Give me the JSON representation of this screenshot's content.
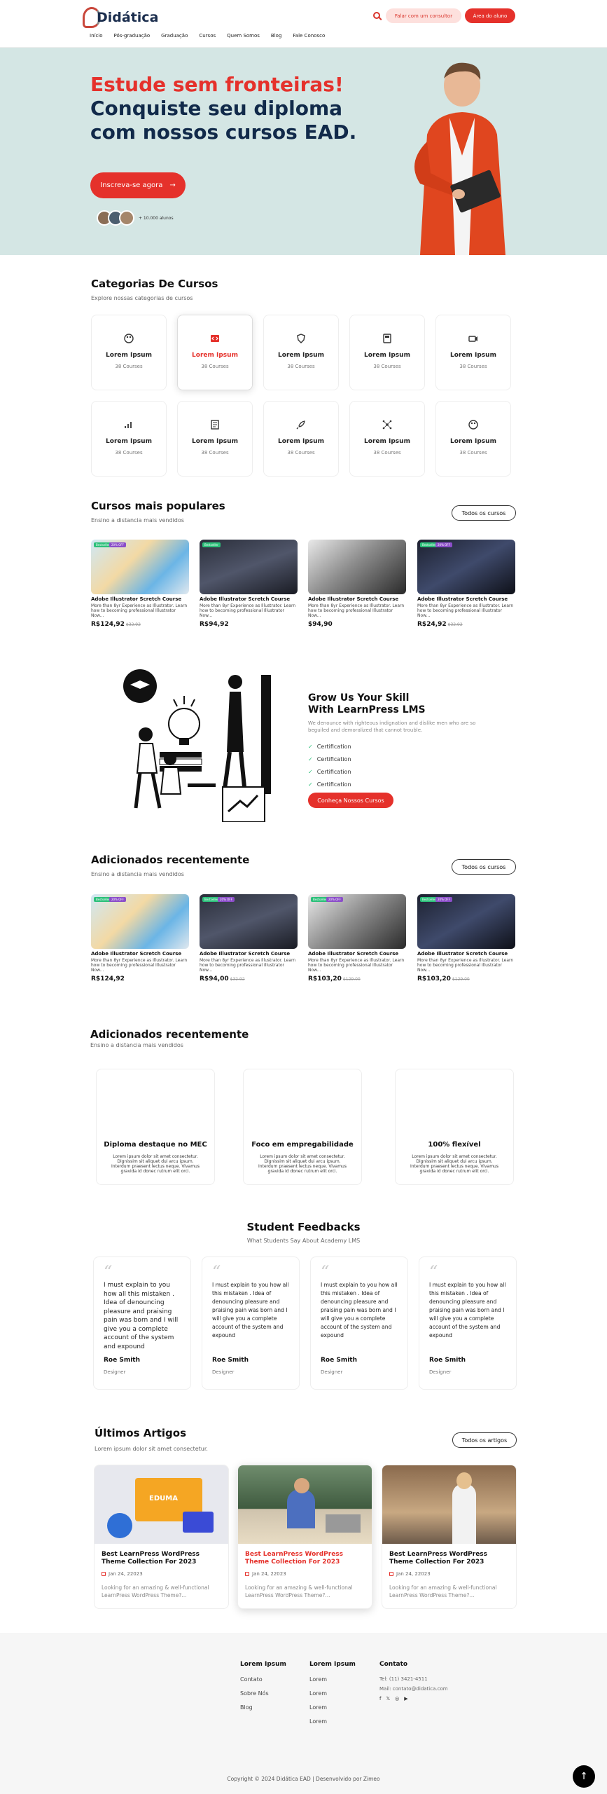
{
  "brand": {
    "logo_text": "Didática",
    "primary_color": "#e5312b",
    "dark_color": "#112a4a"
  },
  "nav": [
    "Início",
    "Pós-graduação",
    "Graduação",
    "Cursos",
    "Quem Somos",
    "Blog",
    "Fale Conosco"
  ],
  "header": {
    "consultor_label": "Falar com um consultor",
    "aluno_label": "Área do aluno"
  },
  "hero": {
    "line1": "Estude sem fronteiras!",
    "line2": "Conquiste seu diploma",
    "line3": "com nossos cursos EAD.",
    "cta": "Inscreva-se agora",
    "students_text": "+ 10.000 alunos"
  },
  "categories": {
    "title": "Categorias De Cursos",
    "subtitle": "Explore nossas categorias de cursos",
    "items": [
      {
        "name": "Lorem Ipsum",
        "count": "38 Courses",
        "icon": "palette-icon"
      },
      {
        "name": "Lorem Ipsum",
        "count": "38 Courses",
        "icon": "code-icon"
      },
      {
        "name": "Lorem Ipsum",
        "count": "38 Courses",
        "icon": "shield-icon"
      },
      {
        "name": "Lorem Ipsum",
        "count": "38 Courses",
        "icon": "calculator-icon"
      },
      {
        "name": "Lorem Ipsum",
        "count": "38 Courses",
        "icon": "camera-icon"
      },
      {
        "name": "Lorem Ipsum",
        "count": "38 Courses",
        "icon": "chart-icon"
      },
      {
        "name": "Lorem Ipsum",
        "count": "38 Courses",
        "icon": "document-icon"
      },
      {
        "name": "Lorem Ipsum",
        "count": "38 Courses",
        "icon": "rocket-icon"
      },
      {
        "name": "Lorem Ipsum",
        "count": "38 Courses",
        "icon": "network-icon"
      },
      {
        "name": "Lorem Ipsum",
        "count": "38 Courses",
        "icon": "palette-icon"
      }
    ]
  },
  "popular": {
    "title": "Cursos mais populares",
    "subtitle": "Ensino a distancia mais vendidos",
    "button": "Todos os cursos",
    "courses": [
      {
        "title": "Adobe Illustrator Scretch Course",
        "desc": "More than 8yr Experience as Illustrator. Learn how to becoming professional Illustrator Now...",
        "price": "R$124,92",
        "old": "$32.92",
        "badges": [
          "Bestseller",
          "20% OFF"
        ]
      },
      {
        "title": "Adobe Illustrator Scretch Course",
        "desc": "More than 8yr Experience as Illustrator. Learn how to becoming professional Illustrator Now...",
        "price": "R$94,92",
        "old": "",
        "badges": [
          "Bestseller"
        ]
      },
      {
        "title": "Adobe Illustrator Scretch Course",
        "desc": "More than 8yr Experience as Illustrator. Learn how to becoming professional Illustrator Now...",
        "price": "$94,90",
        "old": "",
        "badges": []
      },
      {
        "title": "Adobe Illustrator Scretch Course",
        "desc": "More than 8yr Experience as Illustrator. Learn how to becoming professional Illustrator Now...",
        "price": "R$24,92",
        "old": "$32.92",
        "badges": [
          "Bestseller",
          "20% OFF"
        ]
      }
    ]
  },
  "grow": {
    "title_line1": "Grow Us Your Skill",
    "title_line2": "With LearnPress LMS",
    "desc": "We denounce with righteous indignation and dislike men who are so beguiled and demoralized that cannot trouble.",
    "items": [
      "Certification",
      "Certification",
      "Certification",
      "Certification"
    ],
    "button": "Conheça Nossos Cursos"
  },
  "recent": {
    "title": "Adicionados recentemente",
    "subtitle": "Ensino a distancia mais vendidos",
    "button": "Todos os cursos",
    "courses": [
      {
        "title": "Adobe Illustrator Scretch Course",
        "desc": "More than 8yr Experience as Illustrator. Learn how to becoming professional Illustrator Now...",
        "price": "R$124,92",
        "old": "",
        "badges": [
          "Bestseller",
          "20% OFF"
        ]
      },
      {
        "title": "Adobe Illustrator Scretch Course",
        "desc": "More than 8yr Experience as Illustrator. Learn how to becoming professional Illustrator Now...",
        "price": "R$94,00",
        "old": "$32.92",
        "badges": [
          "Bestseller",
          "20% OFF"
        ]
      },
      {
        "title": "Adobe Illustrator Scretch Course",
        "desc": "More than 8yr Experience as Illustrator. Learn how to becoming professional Illustrator Now...",
        "price": "R$103,20",
        "old": "$129.00",
        "badges": [
          "Bestseller",
          "20% OFF"
        ]
      },
      {
        "title": "Adobe Illustrator Scretch Course",
        "desc": "More than 8yr Experience as Illustrator. Learn how to becoming professional Illustrator Now...",
        "price": "R$103,20",
        "old": "$129.00",
        "badges": [
          "Bestseller",
          "20% OFF"
        ]
      }
    ]
  },
  "features": {
    "title": "Adicionados recentemente",
    "subtitle": "Ensino a distancia mais vendidos",
    "items": [
      {
        "title": "Diploma destaque no MEC",
        "desc": "Lorem ipsum dolor sit amet consectetur. Dignissim sit aliquet dui arcu ipsum. Interdum praesent lectus neque. Vivamus gravida id donec rutrum elit orci."
      },
      {
        "title": "Foco em empregabilidade",
        "desc": "Lorem ipsum dolor sit amet consectetur. Dignissim sit aliquet dui arcu ipsum. Interdum praesent lectus neque. Vivamus gravida id donec rutrum elit orci."
      },
      {
        "title": "100% flexível",
        "desc": "Lorem ipsum dolor sit amet consectetur. Dignissim sit aliquet dui arcu ipsum. Interdum praesent lectus neque. Vivamus gravida id donec rutrum elit orci."
      }
    ]
  },
  "feedback": {
    "title": "Student Feedbacks",
    "subtitle": "What Students Say About Academy LMS",
    "items": [
      {
        "text": "I must explain to you how all this mistaken . Idea of denouncing pleasure and praising pain was born and I will give you a complete account of the system and expound",
        "name": "Roe Smith",
        "role": "Designer"
      },
      {
        "text": "I must explain to you how all this mistaken . Idea of denouncing pleasure and praising pain was born and I will give you a complete account of the system and expound",
        "name": "Roe Smith",
        "role": "Designer"
      },
      {
        "text": "I must explain to you how all this mistaken . Idea of denouncing pleasure and praising pain was born and I will give you a complete account of the system and expound",
        "name": "Roe Smith",
        "role": "Designer"
      },
      {
        "text": "I must explain to you how all this mistaken . Idea of denouncing pleasure and praising pain was born and I will give you a complete account of the system and expound",
        "name": "Roe Smith",
        "role": "Designer"
      }
    ]
  },
  "articles": {
    "title": "Últimos Artigos",
    "subtitle": "Lorem ipsum dolor sit amet consectetur.",
    "button": "Todos os artigos",
    "items": [
      {
        "title": "Best LearnPress WordPress Theme Collection For 2023",
        "date": "Jan 24, 22023",
        "excerpt": "Looking for an amazing & well-functional LearnPress WordPress Theme?...",
        "image_label": "EDUMA"
      },
      {
        "title": "Best LearnPress WordPress Theme Collection For 2023",
        "date": "Jan 24, 22023",
        "excerpt": "Looking for an amazing & well-functional LearnPress WordPress Theme?..."
      },
      {
        "title": "Best LearnPress WordPress Theme Collection For 2023",
        "date": "Jan 24, 22023",
        "excerpt": "Looking for an amazing & well-functional LearnPress WordPress Theme?..."
      }
    ]
  },
  "footer": {
    "col1": {
      "title": "Lorem Ipsum",
      "links": [
        "Contato",
        "Sobre Nós",
        "Blog"
      ]
    },
    "col2": {
      "title": "Lorem Ipsum",
      "links": [
        "Lorem",
        "Lorem",
        "Lorem",
        "Lorem"
      ]
    },
    "contact": {
      "title": "Contato",
      "phone": "Tel: (11) 3421-4511",
      "mail": "Mail: contato@didatica.com",
      "socials": [
        "facebook-icon",
        "x-icon",
        "instagram-icon",
        "youtube-icon"
      ]
    },
    "copyright": "Copyright © 2024 Didática EAD | Desenvolvido por Zimeo"
  }
}
